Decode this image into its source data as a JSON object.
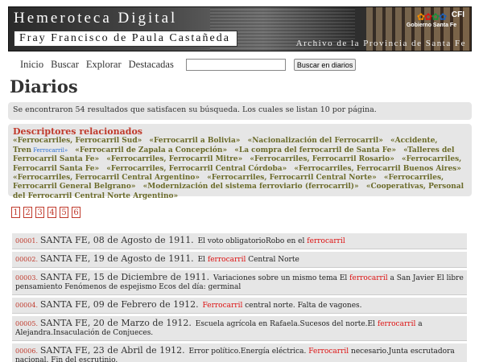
{
  "banner": {
    "title": "Hemeroteca Digital",
    "subtitle": "Fray Francisco de Paula Castañeda",
    "archive": "Archivo de la Provincia de Santa Fe",
    "gov_label": "Gobierno Santa Fe",
    "cfi_label": "CFI"
  },
  "nav": {
    "items": [
      "Inicio",
      "Buscar",
      "Explorar",
      "Destacadas"
    ],
    "search_value": "",
    "search_button": "Buscar en diarios"
  },
  "page_title": "Diarios",
  "results_summary": "Se encontraron 54 resultados que satisfacen su búsqueda. Los cuales se listan 10 por página.",
  "descriptors": {
    "title": "Descriptores relacionados",
    "items": [
      "«Ferrocarriles, Ferrocarril Sud»",
      "«Ferrocarril a Bolivia»",
      "«Nacionalización del Ferrocarril»",
      "«Accidente, Tren",
      "«Ferrocarril de Zapala a Concepción»",
      "«La compra del ferrocarril de Santa Fe»",
      "«Talleres del Ferrocarril Santa Fe»",
      "«Ferrocarriles, Ferrocarril Mitre»",
      "«Ferrocarriles, Ferrocarril Rosario»",
      "«Ferrocarriles, Ferrocarril Santa Fe»",
      "«Ferrocarriles, Ferrocarril Central Córdoba»",
      "«Ferrocarriles, Ferrocarril Buenos Aires»",
      "«Ferrocarriles, Ferrocarril Central Argentino»",
      "«Ferrocarriles, Ferrocarril Central Norte»",
      "«Ferrocarriles, Ferrocarril General Belgrano»",
      "«Modernización del sistema ferroviario (ferrocarril)»",
      "«Cooperativas, Personal del Ferrocarril Central Norte Argentino»"
    ],
    "accidente_extra": "Ferrocarril»"
  },
  "pages": [
    "1",
    "2",
    "3",
    "4",
    "5",
    "6"
  ],
  "results": [
    {
      "num": "00001.",
      "loc": "SANTA FE, 08 de Agosto de 1911.",
      "pre": "El voto obligatorioRobo en el",
      "hl": "ferrocarril",
      "post": ""
    },
    {
      "num": "00002.",
      "loc": "SANTA FE, 19 de Agosto de 1911.",
      "pre": "El",
      "hl": "ferrocarril",
      "post": "Central Norte"
    },
    {
      "num": "00003.",
      "loc": "SANTA FE, 15 de Diciembre de 1911.",
      "pre": "Variaciones sobre un mismo tema El",
      "hl": "ferrocarril",
      "post": "a San Javier El libre pensamiento Fenómenos de espejismo Ecos del día: germinal"
    },
    {
      "num": "00004.",
      "loc": "SANTA FE, 09 de Febrero de 1912.",
      "pre": "",
      "hl": "Ferrocarril",
      "post": "central norte. Falta de vagones."
    },
    {
      "num": "00005.",
      "loc": "SANTA FE, 20 de Marzo de 1912.",
      "pre": "Escuela agrícola en Rafaela.Sucesos del norte.El",
      "hl": "ferrocarril",
      "post": "a Alejandra.Insaculación de Conjueces."
    },
    {
      "num": "00006.",
      "loc": "SANTA FE, 23 de Abril de 1912.",
      "pre": "Error político.Energía eléctrica.",
      "hl": "Ferrocarril",
      "post": "necesario.Junta escrutadora nacional. Fin del escrutinio."
    }
  ]
}
